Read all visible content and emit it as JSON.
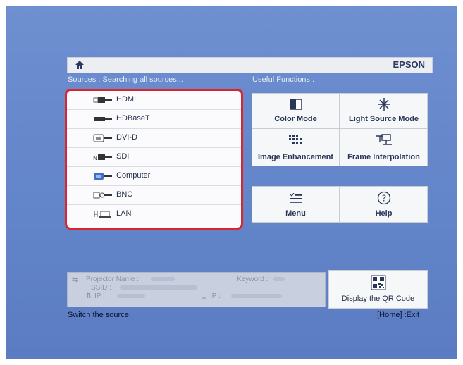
{
  "header": {
    "brand": "EPSON",
    "home_icon": "home-icon"
  },
  "sources": {
    "label": "Sources : Searching all sources...",
    "items": [
      {
        "label": "HDMI",
        "icon": "hdmi-port-icon"
      },
      {
        "label": "HDBaseT",
        "icon": "hdbaset-port-icon"
      },
      {
        "label": "DVI-D",
        "icon": "dvi-port-icon"
      },
      {
        "label": "SDI",
        "icon": "sdi-port-icon"
      },
      {
        "label": "Computer",
        "icon": "vga-port-icon"
      },
      {
        "label": "BNC",
        "icon": "bnc-port-icon"
      },
      {
        "label": "LAN",
        "icon": "lan-port-icon"
      }
    ],
    "highlight_color": "#d9262c"
  },
  "useful": {
    "label": "Useful Functions :",
    "tiles": [
      {
        "label": "Color Mode",
        "icon": "color-mode-icon"
      },
      {
        "label": "Light Source Mode",
        "icon": "light-source-icon"
      },
      {
        "label": "Image Enhancement",
        "icon": "image-enhancement-icon"
      },
      {
        "label": "Frame Interpolation",
        "icon": "frame-interpolation-icon"
      },
      {
        "label": "Menu",
        "icon": "menu-icon"
      },
      {
        "label": "Help",
        "icon": "help-icon"
      }
    ]
  },
  "network": {
    "projector_name_label": "Projector Name :",
    "keyword_label": "Keyword :",
    "ssid_label": "SSID :",
    "ip_label": "IP :",
    "ip2_label": "IP :"
  },
  "qr": {
    "label": "Display the QR Code",
    "icon": "qr-code-icon"
  },
  "status": {
    "hint": "Switch the source.",
    "exit": "[Home] :Exit"
  }
}
